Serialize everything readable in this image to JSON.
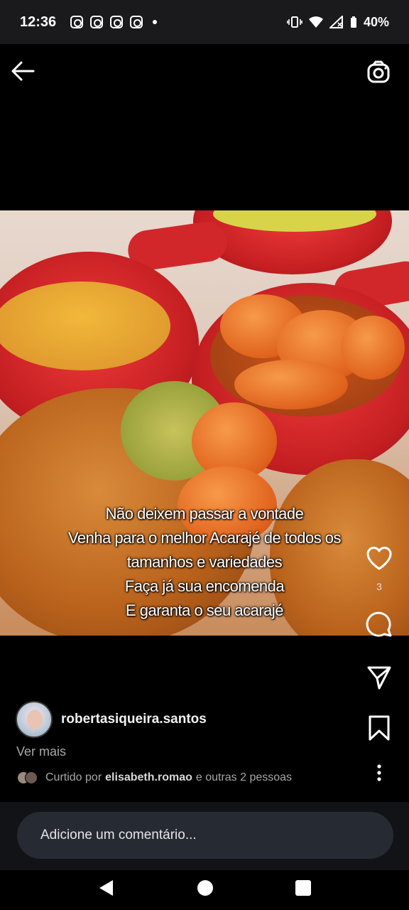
{
  "status_bar": {
    "time": "12:36",
    "battery": "40%",
    "icons": [
      "instagram-icon",
      "instagram-icon",
      "instagram-icon",
      "instagram-icon",
      "vibrate-icon",
      "wifi-icon",
      "signal-icon",
      "battery-icon"
    ]
  },
  "post": {
    "caption_lines": [
      "Não deixem passar a vontade",
      "Venha para o melhor Acarajé de todos os",
      "tamanhos e variedades",
      "Faça já sua encomenda",
      "E garanta o seu acarajé"
    ],
    "like_count": "3",
    "author": "robertasiqueira.santos",
    "ver_mais": "Ver mais",
    "liked_prefix": "Curtido por",
    "liked_user": "elisabeth.romao",
    "liked_suffix": "e outras 2 pessoas"
  },
  "comment": {
    "placeholder": "Adicione um comentário..."
  },
  "colors": {
    "background": "#000000",
    "status_bar": "#1a1a1c",
    "comment_pill": "#262a33",
    "muted_text": "#a8a8a8"
  }
}
